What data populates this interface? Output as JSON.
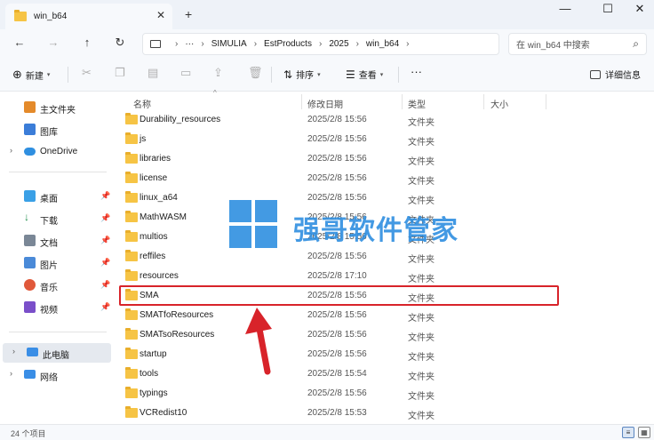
{
  "window": {
    "tab_title": "win_b64",
    "tab_close": "✕",
    "new_tab": "+",
    "minimize": "—",
    "maximize": "☐",
    "close": "✕"
  },
  "address": {
    "back": "←",
    "forward": "→",
    "up": "↑",
    "refresh": "↻",
    "more": "···",
    "crumbs": [
      "SIMULIA",
      "EstProducts",
      "2025",
      "win_b64"
    ],
    "search_placeholder": "在 win_b64 中搜索"
  },
  "toolbar": {
    "new_label": "新建",
    "sort_label": "排序",
    "view_label": "查看",
    "more_label": "···",
    "details_label": "详细信息"
  },
  "sidebar": {
    "home": "主文件夹",
    "gallery": "图库",
    "onedrive": "OneDrive",
    "desktop": "桌面",
    "downloads": "下载",
    "documents": "文档",
    "pictures": "图片",
    "music": "音乐",
    "videos": "视频",
    "thispc": "此电脑",
    "network": "网络"
  },
  "columns": {
    "name": "名称",
    "date": "修改日期",
    "type": "类型",
    "size": "大小"
  },
  "rows": [
    {
      "name": "Durability_resources",
      "date": "2025/2/8 15:56",
      "type": "文件夹"
    },
    {
      "name": "js",
      "date": "2025/2/8 15:56",
      "type": "文件夹"
    },
    {
      "name": "libraries",
      "date": "2025/2/8 15:56",
      "type": "文件夹"
    },
    {
      "name": "license",
      "date": "2025/2/8 15:56",
      "type": "文件夹"
    },
    {
      "name": "linux_a64",
      "date": "2025/2/8 15:56",
      "type": "文件夹"
    },
    {
      "name": "MathWASM",
      "date": "2025/2/8 15:56",
      "type": "文件夹"
    },
    {
      "name": "multios",
      "date": "2025/2/8 15:56",
      "type": "文件夹"
    },
    {
      "name": "reffiles",
      "date": "2025/2/8 15:56",
      "type": "文件夹"
    },
    {
      "name": "resources",
      "date": "2025/2/8 17:10",
      "type": "文件夹"
    },
    {
      "name": "SMA",
      "date": "2025/2/8 15:56",
      "type": "文件夹"
    },
    {
      "name": "SMATfoResources",
      "date": "2025/2/8 15:56",
      "type": "文件夹"
    },
    {
      "name": "SMATsoResources",
      "date": "2025/2/8 15:56",
      "type": "文件夹"
    },
    {
      "name": "startup",
      "date": "2025/2/8 15:56",
      "type": "文件夹"
    },
    {
      "name": "tools",
      "date": "2025/2/8 15:54",
      "type": "文件夹"
    },
    {
      "name": "typings",
      "date": "2025/2/8 15:56",
      "type": "文件夹"
    },
    {
      "name": "VCRedist10",
      "date": "2025/2/8 15:53",
      "type": "文件夹"
    }
  ],
  "watermark": "强哥软件管家",
  "status": {
    "count": "24 个项目"
  },
  "colors": {
    "folder": "#f6c445",
    "highlight": "#d8232a",
    "arrow": "#d8232a",
    "watermark": "#2f8fe0"
  }
}
